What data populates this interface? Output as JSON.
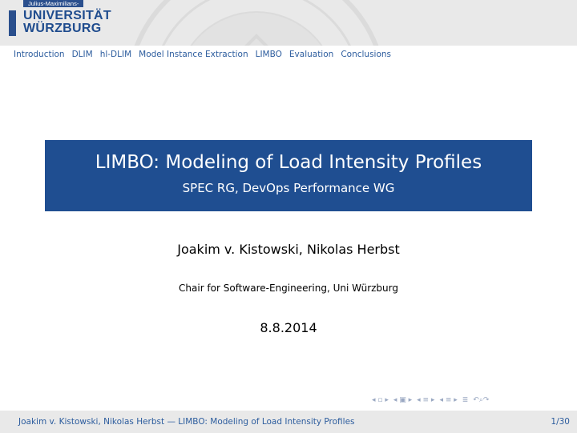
{
  "header": {
    "logo_sub": "Julius-Maximilians-",
    "logo_line1": "UNIVERSITÄT",
    "logo_line2": "WÜRZBURG"
  },
  "nav": {
    "items": [
      "Introduction",
      "DLIM",
      "hl-DLIM",
      "Model Instance Extraction",
      "LIMBO",
      "Evaluation",
      "Conclusions"
    ]
  },
  "title": {
    "main": "LIMBO: Modeling of Load Intensity Profiles",
    "sub": "SPEC RG, DevOps Performance WG"
  },
  "author": "Joakim v. Kistowski, Nikolas Herbst",
  "institute": "Chair for Software-Engineering, Uni Würzburg",
  "date": "8.8.2014",
  "beamer_nav": {
    "icons": [
      "frame-nav-icon",
      "subsection-nav-icon",
      "section-nav-icon",
      "slide-nav-icon",
      "align-icon",
      "search-icon"
    ]
  },
  "footer": {
    "left": "Joakim v. Kistowski, Nikolas Herbst — LIMBO: Modeling of Load Intensity Profiles",
    "page": "1/30"
  }
}
